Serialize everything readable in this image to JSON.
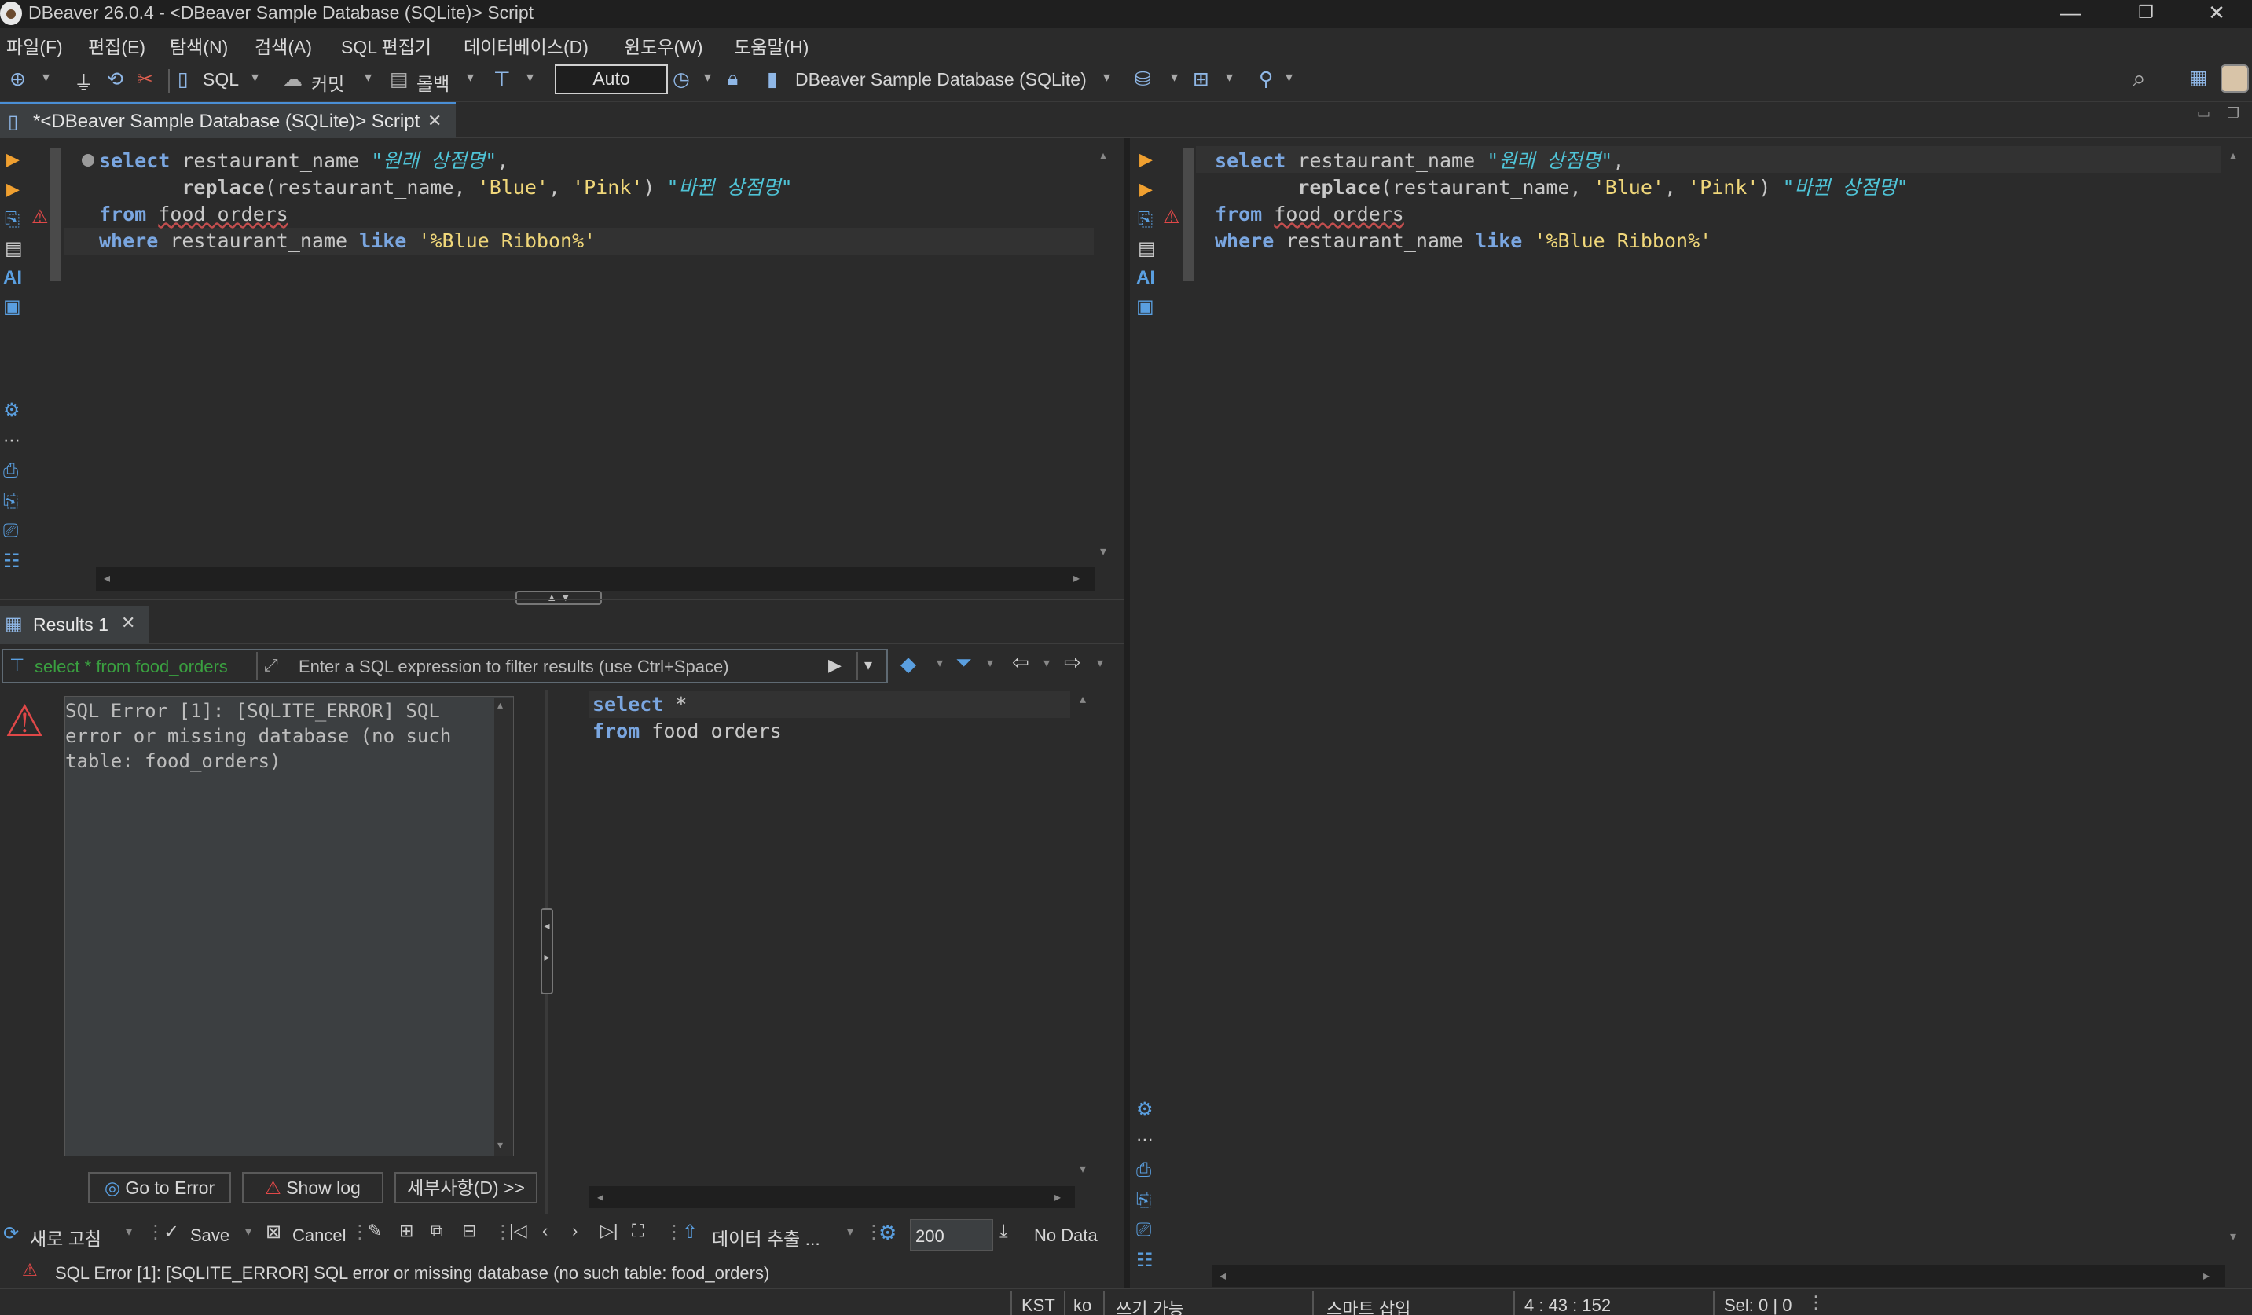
{
  "window": {
    "title": "DBeaver 26.0.4 - <DBeaver Sample Database (SQLite)> Script",
    "minimize": "—",
    "restore": "❐",
    "close": "✕"
  },
  "menu": [
    {
      "label": "파일(F)"
    },
    {
      "label": "편집(E)"
    },
    {
      "label": "탐색(N)"
    },
    {
      "label": "검색(A)"
    },
    {
      "label": "SQL 편집기"
    },
    {
      "label": "데이터베이스(D)"
    },
    {
      "label": "윈도우(W)"
    },
    {
      "label": "도움말(H)"
    }
  ],
  "toolbar": {
    "sql_label": "SQL",
    "commit_label": "커밋",
    "rollback_label": "롤백",
    "tx_mode": "Auto",
    "datasource": "DBeaver Sample Database (SQLite)"
  },
  "editor_tab": {
    "label": "*<DBeaver Sample Database (SQLite)> Script"
  },
  "sql_code": {
    "l1_kw": "select",
    "l1_col": " restaurant_name ",
    "l1_alias": "\"원래 상점명\"",
    "l1_end": ",",
    "l2_indent": "       ",
    "l2_fn": "replace",
    "l2_args1": "(restaurant_name, ",
    "l2_s1": "'Blue'",
    "l2_comma": ", ",
    "l2_s2": "'Pink'",
    "l2_close": ") ",
    "l2_alias": "\"바뀐 상점명\"",
    "l3_kw": "from",
    "l3_sp": " ",
    "l3_tbl": "food_orders",
    "l4_kw": "where",
    "l4_col": " restaurant_name ",
    "l4_like": "like",
    "l4_sp": " ",
    "l4_str": "'%Blue Ribbon%'"
  },
  "results": {
    "tab_label": "Results 1",
    "filter_query": "select * from food_orders",
    "filter_placeholder": "Enter a SQL expression to filter results (use Ctrl+Space)",
    "error_text": "SQL Error [1]: [SQLITE_ERROR] SQL error or missing database (no such table: food_orders)",
    "query_kw1": "select",
    "query_star": " *",
    "query_kw2": "from",
    "query_tbl": " food_orders",
    "go_to_error": "Go to Error",
    "show_log": "Show log",
    "details": "세부사항(D) >>",
    "refresh": "새로 고침",
    "save": "Save",
    "cancel": "Cancel",
    "export": "데이터 추출 ...",
    "fetch_size": "200",
    "no_data": "No Data",
    "status_message": "SQL Error [1]: [SQLITE_ERROR] SQL error or missing database (no such table: food_orders)"
  },
  "statusbar": {
    "timezone": "KST",
    "locale": "ko",
    "writable": "쓰기 가능",
    "insert_mode": "스마트 삽입",
    "position": "4 : 43 : 152",
    "selection": "Sel: 0 | 0"
  }
}
